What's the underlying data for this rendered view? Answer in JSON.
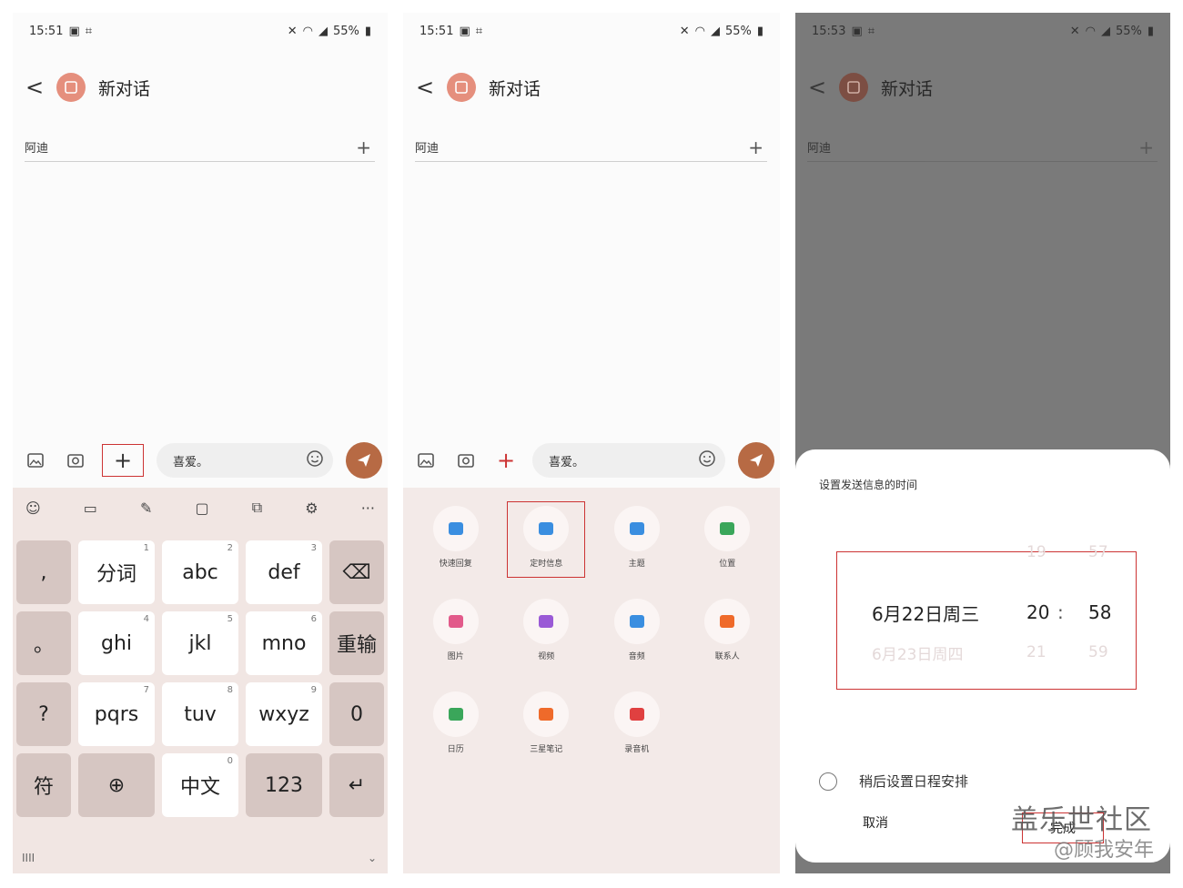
{
  "screens": [
    {
      "status": {
        "time": "15:51",
        "battery": "55%"
      },
      "header": {
        "back": "<",
        "title": "新对话"
      },
      "recipient": {
        "name": "阿迪"
      },
      "composer": {
        "message": "喜爱。"
      },
      "keyboard": {
        "toolbar_more": "···",
        "keys": [
          {
            "label": ",",
            "num": "",
            "fn": true
          },
          {
            "label": "分词",
            "num": "1",
            "fn": false
          },
          {
            "label": "abc",
            "num": "2",
            "fn": false
          },
          {
            "label": "def",
            "num": "3",
            "fn": false
          },
          {
            "label": "⌫",
            "num": "",
            "fn": true
          },
          {
            "label": "。",
            "num": "",
            "fn": true
          },
          {
            "label": "ghi",
            "num": "4",
            "fn": false
          },
          {
            "label": "jkl",
            "num": "5",
            "fn": false
          },
          {
            "label": "mno",
            "num": "6",
            "fn": false
          },
          {
            "label": "重输",
            "num": "",
            "fn": true
          },
          {
            "label": "?",
            "num": "",
            "fn": true
          },
          {
            "label": "pqrs",
            "num": "7",
            "fn": false
          },
          {
            "label": "tuv",
            "num": "8",
            "fn": false
          },
          {
            "label": "wxyz",
            "num": "9",
            "fn": false
          },
          {
            "label": "0",
            "num": "",
            "fn": true
          },
          {
            "label": "符",
            "num": "",
            "fn": true
          },
          {
            "label": "⊕",
            "num": "",
            "fn": true
          },
          {
            "label": "中文",
            "num": "0",
            "fn": false
          },
          {
            "label": "123",
            "num": "",
            "fn": true
          },
          {
            "label": "↵",
            "num": "",
            "fn": true
          }
        ],
        "footer_left": "IIII",
        "footer_right": "⌄"
      }
    },
    {
      "status": {
        "time": "15:51",
        "battery": "55%"
      },
      "header": {
        "back": "<",
        "title": "新对话"
      },
      "recipient": {
        "name": "阿迪"
      },
      "composer": {
        "message": "喜爱。"
      },
      "attachments": [
        {
          "label": "快速回复",
          "color": "#3a8ee0",
          "selected": false
        },
        {
          "label": "定时信息",
          "color": "#3a8ee0",
          "selected": true
        },
        {
          "label": "主题",
          "color": "#3a8ee0",
          "selected": false
        },
        {
          "label": "位置",
          "color": "#3aa65a",
          "selected": false
        },
        {
          "label": "图片",
          "color": "#e25a8a",
          "selected": false
        },
        {
          "label": "视频",
          "color": "#9a5ad6",
          "selected": false
        },
        {
          "label": "音频",
          "color": "#3a8ee0",
          "selected": false
        },
        {
          "label": "联系人",
          "color": "#ef6a2a",
          "selected": false
        },
        {
          "label": "日历",
          "color": "#3aa65a",
          "selected": false
        },
        {
          "label": "三星笔记",
          "color": "#ef6a2a",
          "selected": false
        },
        {
          "label": "录音机",
          "color": "#e04040",
          "selected": false
        }
      ]
    },
    {
      "status": {
        "time": "15:53",
        "battery": "55%"
      },
      "header": {
        "back": "<",
        "title": "新对话"
      },
      "recipient": {
        "name": "阿迪"
      },
      "dialog": {
        "title": "设置发送信息的时间",
        "prev": {
          "date": "",
          "hour": "19",
          "minute": "57"
        },
        "selected": {
          "date": "6月22日周三",
          "hour": "20",
          "minute": "58"
        },
        "next": {
          "date": "6月23日周四",
          "hour": "21",
          "minute": "59"
        },
        "separator": ":",
        "later_label": "稍后设置日程安排",
        "cancel": "取消",
        "ok": "完成"
      }
    }
  ],
  "watermark": {
    "line1": "盖乐世社区",
    "line2": "@顾我安年"
  },
  "colors": {
    "accent_red": "#cc3333",
    "send": "#b76a44"
  }
}
